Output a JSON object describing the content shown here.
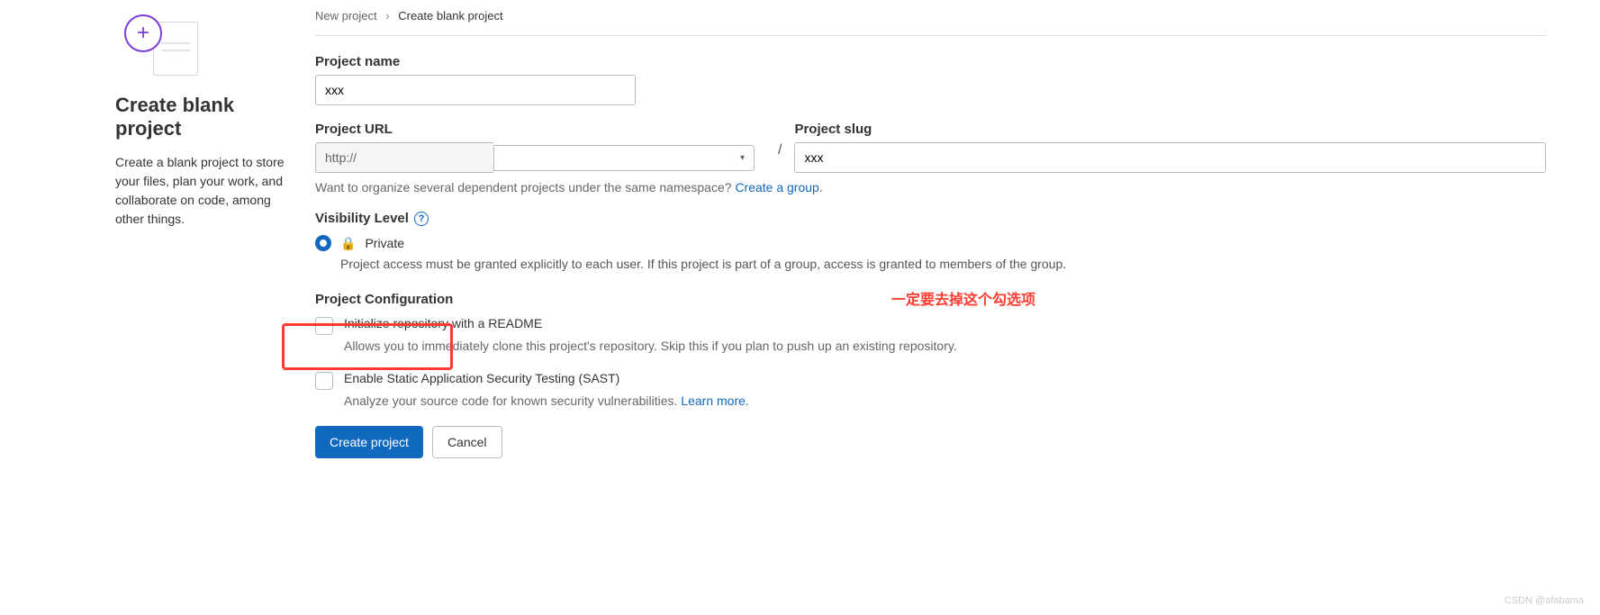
{
  "breadcrumb": {
    "parent": "New project",
    "current": "Create blank project"
  },
  "sidebar": {
    "title": "Create blank project",
    "description": "Create a blank project to store your files, plan your work, and collaborate on code, among other things."
  },
  "form": {
    "name_label": "Project name",
    "name_value": "xxx",
    "url_label": "Project URL",
    "url_prefix": "http://",
    "url_namespace": "",
    "slash": "/",
    "slug_label": "Project slug",
    "slug_value": "xxx",
    "namespace_hint_prefix": "Want to organize several dependent projects under the same namespace? ",
    "namespace_hint_link": "Create a group",
    "visibility_label": "Visibility Level",
    "visibility_option": "Private",
    "visibility_desc": "Project access must be granted explicitly to each user. If this project is part of a group, access is granted to members of the group.",
    "config_label": "Project Configuration",
    "readme_label": "Initialize repository with a README",
    "readme_desc": "Allows you to immediately clone this project's repository. Skip this if you plan to push up an existing repository.",
    "sast_label": "Enable Static Application Security Testing (SAST)",
    "sast_desc_prefix": "Analyze your source code for known security vulnerabilities. ",
    "sast_link": "Learn more.",
    "submit": "Create project",
    "cancel": "Cancel"
  },
  "annotation": "一定要去掉这个勾选项",
  "watermark": "CSDN @afabama"
}
